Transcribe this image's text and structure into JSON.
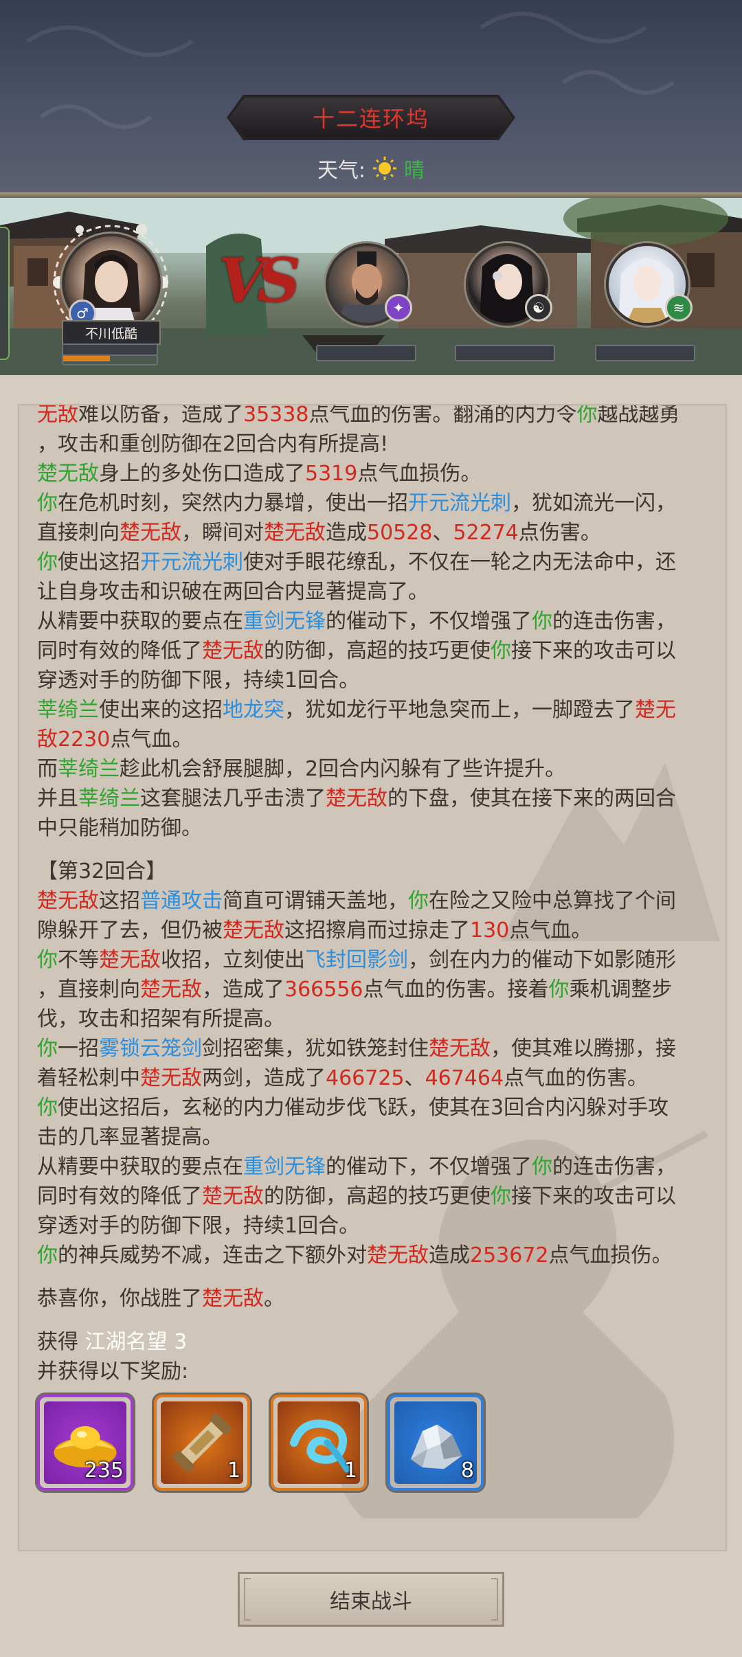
{
  "header": {
    "location_title": "十二连环坞",
    "weather_label": "天气:",
    "weather_value": "晴",
    "weather_icon": "sun-icon"
  },
  "battle": {
    "player_name": "不川低酷",
    "player_gender_icon": "male-icon",
    "vs_label": "VS",
    "opponents": [
      {
        "icon": "sword-sect-icon",
        "badge_color": "#7e44c4"
      },
      {
        "icon": "yin-yang-icon",
        "badge_color": "#2f2f33"
      },
      {
        "icon": "wind-icon",
        "badge_color": "#2e8a44"
      }
    ]
  },
  "log": {
    "lines": [
      [
        [
          "r",
          "无敌"
        ],
        [
          "t",
          "难以防备，造成了"
        ],
        [
          "r",
          "35338"
        ],
        [
          "t",
          "点气血的伤害。翻涌的内力令"
        ],
        [
          "g",
          "你"
        ],
        [
          "t",
          "越战越勇"
        ]
      ],
      [
        [
          "t",
          "，攻击和重创防御在2回合内有所提高!"
        ]
      ],
      [
        [
          "g",
          "楚无敌"
        ],
        [
          "t",
          "身上的多处伤口造成了"
        ],
        [
          "r",
          "5319"
        ],
        [
          "t",
          "点气血损伤。"
        ]
      ],
      [
        [
          "g",
          "你"
        ],
        [
          "t",
          "在危机时刻，突然内力暴增，使出一招"
        ],
        [
          "b",
          "开元流光刺"
        ],
        [
          "t",
          "，犹如流光一闪，"
        ]
      ],
      [
        [
          "t",
          "直接刺向"
        ],
        [
          "r",
          "楚无敌"
        ],
        [
          "t",
          "，瞬间对"
        ],
        [
          "r",
          "楚无敌"
        ],
        [
          "t",
          "造成"
        ],
        [
          "r",
          "50528"
        ],
        [
          "t",
          "、"
        ],
        [
          "r",
          "52274"
        ],
        [
          "t",
          "点伤害。"
        ]
      ],
      [
        [
          "g",
          "你"
        ],
        [
          "t",
          "使出这招"
        ],
        [
          "b",
          "开元流光刺"
        ],
        [
          "t",
          "使对手眼花缭乱，不仅在一轮之内无法命中，还"
        ]
      ],
      [
        [
          "t",
          "让自身攻击和识破在两回合内显著提高了。"
        ]
      ],
      [
        [
          "t",
          "从精要中获取的要点在"
        ],
        [
          "b",
          "重剑无锋"
        ],
        [
          "t",
          "的催动下，不仅增强了"
        ],
        [
          "g",
          "你"
        ],
        [
          "t",
          "的连击伤害，"
        ]
      ],
      [
        [
          "t",
          "同时有效的降低了"
        ],
        [
          "r",
          "楚无敌"
        ],
        [
          "t",
          "的防御，高超的技巧更使"
        ],
        [
          "g",
          "你"
        ],
        [
          "t",
          "接下来的攻击可以"
        ]
      ],
      [
        [
          "t",
          "穿透对手的防御下限，持续1回合。"
        ]
      ],
      [
        [
          "g",
          "莘绮兰"
        ],
        [
          "t",
          "使出来的这招"
        ],
        [
          "b",
          "地龙突"
        ],
        [
          "t",
          "，犹如龙行平地急突而上，一脚蹬去了"
        ],
        [
          "r",
          "楚无"
        ]
      ],
      [
        [
          "r",
          "敌2230"
        ],
        [
          "t",
          "点气血。"
        ]
      ],
      [
        [
          "t",
          "而"
        ],
        [
          "g",
          "莘绮兰"
        ],
        [
          "t",
          "趁此机会舒展腿脚，2回合内闪躲有了些许提升。"
        ]
      ],
      [
        [
          "t",
          "并且"
        ],
        [
          "g",
          "莘绮兰"
        ],
        [
          "t",
          "这套腿法几乎击溃了"
        ],
        [
          "r",
          "楚无敌"
        ],
        [
          "t",
          "的下盘，使其在接下来的两回合"
        ]
      ],
      [
        [
          "t",
          "中只能稍加防御。"
        ]
      ],
      "gap",
      [
        [
          "t",
          "【第32回合】"
        ]
      ],
      [
        [
          "r",
          "楚无敌"
        ],
        [
          "t",
          "这招"
        ],
        [
          "b",
          "普通攻击"
        ],
        [
          "t",
          "简直可谓铺天盖地，"
        ],
        [
          "g",
          "你"
        ],
        [
          "t",
          "在险之又险中总算找了个间"
        ]
      ],
      [
        [
          "t",
          "隙躲开了去，但仍被"
        ],
        [
          "r",
          "楚无敌"
        ],
        [
          "t",
          "这招擦肩而过掠走了"
        ],
        [
          "r",
          "130"
        ],
        [
          "t",
          "点气血。"
        ]
      ],
      [
        [
          "g",
          "你"
        ],
        [
          "t",
          "不等"
        ],
        [
          "r",
          "楚无敌"
        ],
        [
          "t",
          "收招，立刻使出"
        ],
        [
          "b",
          "飞封回影剑"
        ],
        [
          "t",
          "，剑在内力的催动下如影随形"
        ]
      ],
      [
        [
          "t",
          "，直接刺向"
        ],
        [
          "r",
          "楚无敌"
        ],
        [
          "t",
          "，造成了"
        ],
        [
          "r",
          "366556"
        ],
        [
          "t",
          "点气血的伤害。接着"
        ],
        [
          "g",
          "你"
        ],
        [
          "t",
          "乘机调整步"
        ]
      ],
      [
        [
          "t",
          "伐，攻击和招架有所提高。"
        ]
      ],
      [
        [
          "g",
          "你"
        ],
        [
          "t",
          "一招"
        ],
        [
          "b",
          "雾锁云笼剑"
        ],
        [
          "t",
          "剑招密集，犹如铁笼封住"
        ],
        [
          "r",
          "楚无敌"
        ],
        [
          "t",
          "，使其难以腾挪，接"
        ]
      ],
      [
        [
          "t",
          "着轻松刺中"
        ],
        [
          "r",
          "楚无敌"
        ],
        [
          "t",
          "两剑，造成了"
        ],
        [
          "r",
          "466725"
        ],
        [
          "t",
          "、"
        ],
        [
          "r",
          "467464"
        ],
        [
          "t",
          "点气血的伤害。"
        ]
      ],
      [
        [
          "g",
          "你"
        ],
        [
          "t",
          "使出这招后，玄秘的内力催动步伐飞跃，使其在3回合内闪躲对手攻"
        ]
      ],
      [
        [
          "t",
          "击的几率显著提高。"
        ]
      ],
      [
        [
          "t",
          "从精要中获取的要点在"
        ],
        [
          "b",
          "重剑无锋"
        ],
        [
          "t",
          "的催动下，不仅增强了"
        ],
        [
          "g",
          "你"
        ],
        [
          "t",
          "的连击伤害，"
        ]
      ],
      [
        [
          "t",
          "同时有效的降低了"
        ],
        [
          "r",
          "楚无敌"
        ],
        [
          "t",
          "的防御，高超的技巧更使"
        ],
        [
          "g",
          "你"
        ],
        [
          "t",
          "接下来的攻击可以"
        ]
      ],
      [
        [
          "t",
          "穿透对手的防御下限，持续1回合。"
        ]
      ],
      [
        [
          "g",
          "你"
        ],
        [
          "t",
          "的神兵威势不减，连击之下额外对"
        ],
        [
          "r",
          "楚无敌"
        ],
        [
          "t",
          "造成"
        ],
        [
          "r",
          "253672"
        ],
        [
          "t",
          "点气血损伤。"
        ]
      ],
      "gap",
      [
        [
          "t",
          "恭喜你，你战胜了"
        ],
        [
          "r",
          "楚无敌"
        ],
        [
          "t",
          "。"
        ]
      ],
      "gap",
      [
        [
          "t",
          "获得 "
        ],
        [
          "w",
          "江湖名望 3"
        ]
      ],
      [
        [
          "t",
          "并获得以下奖励:"
        ]
      ]
    ],
    "rewards": [
      {
        "icon": "gold-ingot-icon",
        "count": "235",
        "rarity_color": "#a43bd1"
      },
      {
        "icon": "scroll-icon",
        "count": "1",
        "rarity_color": "#e07719"
      },
      {
        "icon": "cloud-swirl-icon",
        "count": "1",
        "rarity_color": "#e07719"
      },
      {
        "icon": "ore-crystal-icon",
        "count": "8",
        "rarity_color": "#2f7fe0"
      }
    ]
  },
  "footer": {
    "end_battle_label": "结束战斗"
  }
}
